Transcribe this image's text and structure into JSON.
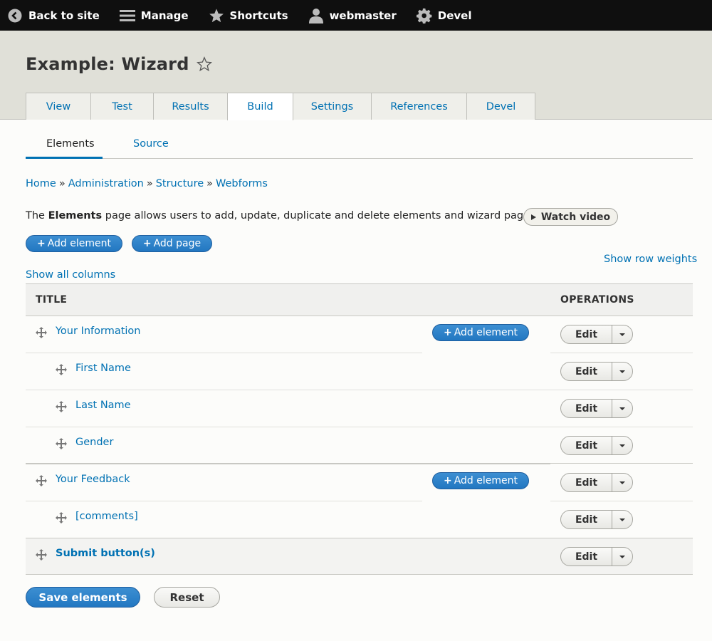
{
  "toolbar": {
    "back": "Back to site",
    "manage": "Manage",
    "shortcuts": "Shortcuts",
    "user": "webmaster",
    "devel": "Devel"
  },
  "page": {
    "title": "Example: Wizard"
  },
  "tabs": [
    "View",
    "Test",
    "Results",
    "Build",
    "Settings",
    "References",
    "Devel"
  ],
  "active_tab": "Build",
  "subtabs": [
    "Elements",
    "Source"
  ],
  "active_subtab": "Elements",
  "breadcrumb": [
    "Home",
    "Administration",
    "Structure",
    "Webforms"
  ],
  "breadcrumb_separator": "»",
  "description": {
    "prefix": "The ",
    "bold": "Elements",
    "suffix": " page allows users to add, update, duplicate and delete elements and wizard pages."
  },
  "watch_video": "Watch video",
  "add_element": "Add element",
  "add_page": "Add page",
  "plus": "+",
  "show_row_weights": "Show row weights",
  "show_all_columns": "Show all columns",
  "table": {
    "col_title": "TITLE",
    "col_operations": "OPERATIONS",
    "edit_label": "Edit",
    "rows": [
      {
        "title": "Your Information",
        "level": 0,
        "add": true,
        "bold": false
      },
      {
        "title": "First Name",
        "level": 1,
        "add": false,
        "bold": false
      },
      {
        "title": "Last Name",
        "level": 1,
        "add": false,
        "bold": false
      },
      {
        "title": "Gender",
        "level": 1,
        "add": false,
        "bold": false
      },
      {
        "title": "Your Feedback",
        "level": 0,
        "add": true,
        "bold": false
      },
      {
        "title": "[comments]",
        "level": 1,
        "add": false,
        "bold": false
      },
      {
        "title": "Submit button(s)",
        "level": 0,
        "add": false,
        "bold": true
      }
    ]
  },
  "save_elements": "Save elements",
  "reset": "Reset",
  "colors": {
    "link": "#0071b3",
    "toolbar": "#0f0f0f",
    "header": "#e0e0d8",
    "primary_button": "#2a7fc9"
  }
}
